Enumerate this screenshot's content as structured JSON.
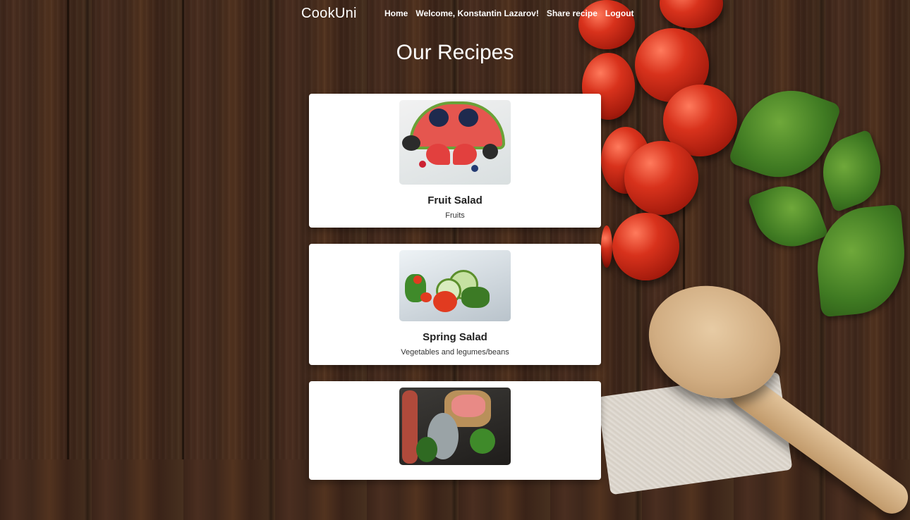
{
  "nav": {
    "brand": "CookUni",
    "links": [
      "Home",
      "Welcome, Konstantin Lazarov!",
      "Share recipe",
      "Logout"
    ]
  },
  "page": {
    "title": "Our Recipes"
  },
  "recipes": [
    {
      "name": "Fruit Salad",
      "category": "Fruits",
      "image": "fruit-salad-image"
    },
    {
      "name": "Spring Salad",
      "category": "Vegetables and legumes/beans",
      "image": "spring-salad-image"
    },
    {
      "name": "",
      "category": "",
      "image": "meat-fish-image"
    }
  ],
  "colors": {
    "card_bg": "#ffffff",
    "text_on_bg": "#ffffff",
    "wood": "#3f281c",
    "tomato": "#d8321c",
    "basil": "#3f7a22"
  }
}
